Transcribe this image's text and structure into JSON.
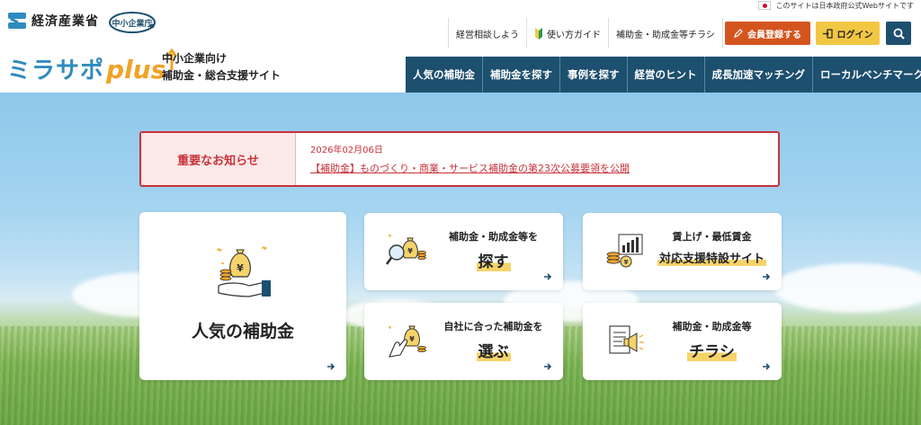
{
  "header": {
    "gov_notice": "このサイトは日本政府公式Webサイトです",
    "meti_name": "経済産業省",
    "chusho_name": "中小企業庁",
    "logo_main": "ミラサポ",
    "logo_plus": "plus",
    "tagline_line1": "中小企業向け",
    "tagline_line2": "補助金・総合支援サイト",
    "top_links": [
      "経営相談しよう",
      "使い方ガイド",
      "補助金・助成金等チラシ"
    ],
    "register_label": "会員登録する",
    "login_label": "ログイン"
  },
  "nav": {
    "items": [
      "人気の補助金",
      "補助金を探す",
      "事例を探す",
      "経営のヒント",
      "成長加速マッチング",
      "ローカルベンチマーク"
    ]
  },
  "notice": {
    "label": "重要なお知らせ",
    "date": "2026年02月06日",
    "link_text": "【補助金】ものづくり・商業・サービス補助金の第23次公募要領を公開"
  },
  "cards": {
    "popular": {
      "title": "人気の補助金",
      "icon": "money-bag-hand-icon"
    },
    "search": {
      "line1": "補助金・助成金等を",
      "line2": "探す",
      "icon": "money-bag-magnifier-icon"
    },
    "wage": {
      "line1": "賃上げ・最低賃金",
      "line2": "対応支援特設サイト",
      "icon": "coins-chart-icon"
    },
    "choose": {
      "line1": "自社に合った補助金を",
      "line2": "選ぶ",
      "icon": "hand-money-bag-icon"
    },
    "flyer": {
      "line1": "補助金・助成金等",
      "line2": "チラシ",
      "icon": "flyer-megaphone-icon"
    }
  },
  "colors": {
    "nav_bg": "#1d4f6e",
    "register_bg": "#d4541e",
    "login_bg": "#f2c744",
    "notice_red": "#c8323a",
    "logo_blue": "#2f8bbf",
    "logo_orange": "#f0a326"
  }
}
